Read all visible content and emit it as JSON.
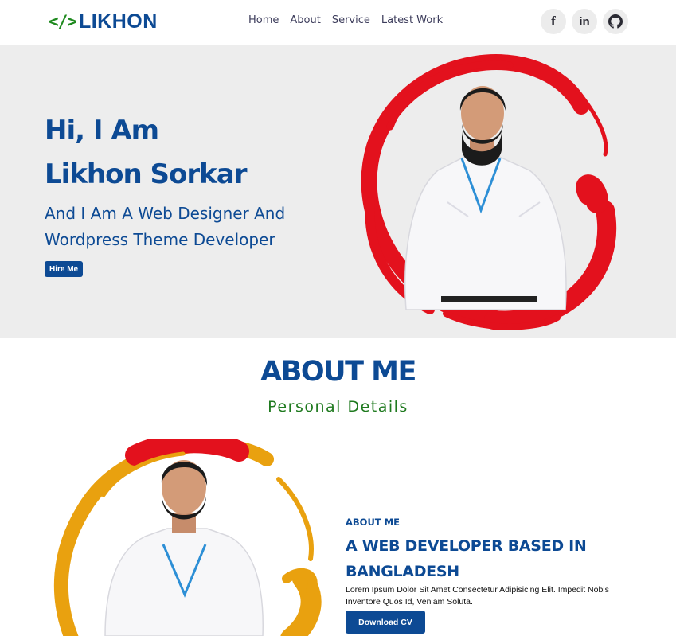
{
  "nav": {
    "logo_icon": "</>",
    "logo_text": "LIKHON",
    "menu": [
      "Home",
      "About",
      "Service",
      "Latest Work"
    ],
    "socials": [
      {
        "icon": "facebook-icon",
        "glyph": "f"
      },
      {
        "icon": "linkedin-icon",
        "glyph": "in"
      },
      {
        "icon": "github-icon"
      }
    ]
  },
  "hero": {
    "title_line1": "Hi, I Am",
    "title_line2": "Likhon Sorkar",
    "subtitle": "And I Am A Web Designer And Wordpress Theme Developer",
    "button": "Hire Me",
    "ring_color": "#e3111d"
  },
  "about": {
    "heading": "ABOUT ME",
    "subheading": "Personal Details",
    "label": "ABOUT ME",
    "title": "A WEB DEVELOPER BASED IN BANGLADESH",
    "text": "Lorem Ipsum Dolor Sit Amet Consectetur Adipisicing Elit. Impedit Nobis Inventore Quos Id, Veniam Soluta.",
    "button": "Download CV",
    "ring_color": "#e9a10f",
    "ring_accent": "#e3111d"
  },
  "colors": {
    "primary": "#0d4a94",
    "accent_green": "#1f7a1f",
    "hero_bg": "#ededed"
  }
}
